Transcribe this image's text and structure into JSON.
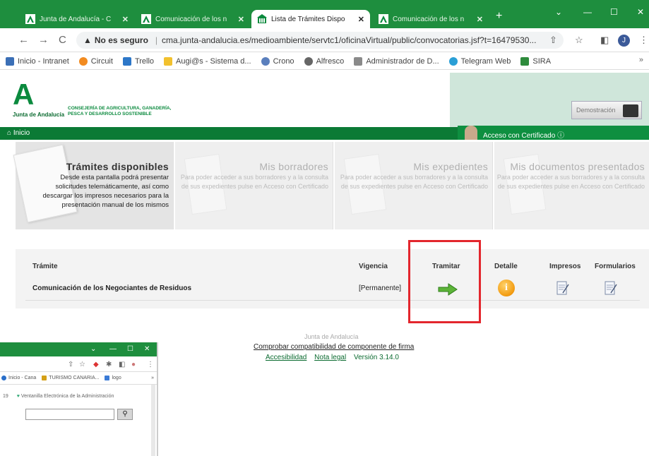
{
  "browser": {
    "tabs": [
      {
        "title": "Junta de Andalucía - C",
        "active": false
      },
      {
        "title": "Comunicación de los n",
        "active": false
      },
      {
        "title": "Lista de Trámites Dispo",
        "active": true
      },
      {
        "title": "Comunicación de los n",
        "active": false
      }
    ],
    "new_tab": "+",
    "window_controls": {
      "minimize": "—",
      "maximize": "☐",
      "close": "✕",
      "chevron": "⌄"
    },
    "nav": {
      "back": "←",
      "forward": "→",
      "reload": "C"
    },
    "address": {
      "security_label": "No es seguro",
      "url": "cma.junta-andalucia.es/medioambiente/servtc1/oficinaVirtual/public/convocatorias.jsf?t=16479530..."
    },
    "profile_initial": "J",
    "bookmarks": [
      {
        "label": "Inicio - Intranet",
        "color": "#3b6fb6"
      },
      {
        "label": "Circuit",
        "color": "#f28b20"
      },
      {
        "label": "Trello",
        "color": "#2d77c8"
      },
      {
        "label": "Augi@s - Sistema d...",
        "color": "#f2c12e"
      },
      {
        "label": "Crono",
        "color": "#5a7fbd"
      },
      {
        "label": "Alfresco",
        "color": "#666666"
      },
      {
        "label": "Administrador de D...",
        "color": "#8a8a8a"
      },
      {
        "label": "Telegram Web",
        "color": "#2a9fd6"
      },
      {
        "label": "SIRA",
        "color": "#2e8b3c"
      }
    ],
    "bookmarks_more": "»"
  },
  "header": {
    "logo_letter": "A",
    "logo_org": "Junta de Andalucía",
    "logo_consejeria_line1": "CONSEJERÍA DE AGRICULTURA, GANADERÍA,",
    "logo_consejeria_line2": "PESCA Y DESARROLLO SOSTENIBLE",
    "demo_button": "Demostración"
  },
  "navbar": {
    "home": "Inicio",
    "access": "Acceso con Certificado"
  },
  "panels": [
    {
      "title": "Trámites disponibles",
      "desc": "Desde esta pantalla podrá presentar solicitudes telemáticamente, así como descargar los impresos necesarios para la presentación manual de los mismos"
    },
    {
      "title": "Mis borradores",
      "desc": "Para poder acceder a sus borradores y a la consulta de sus expedientes pulse en Acceso con Certificado"
    },
    {
      "title": "Mis expedientes",
      "desc": "Para poder acceder a sus borradores y a la consulta de sus expedientes pulse en Acceso con Certificado"
    },
    {
      "title": "Mis documentos presentados",
      "desc": "Para poder acceder a sus borradores y a la consulta de sus expedientes pulse en Acceso con Certificado"
    }
  ],
  "table": {
    "headers": {
      "tramite": "Trámite",
      "vigencia": "Vigencia",
      "tramitar": "Tramitar",
      "detalle": "Detalle",
      "impresos": "Impresos",
      "formularios": "Formularios"
    },
    "rows": [
      {
        "tramite": "Comunicación de los Negociantes de Residuos",
        "vigencia": "[Permanente]"
      }
    ]
  },
  "footer": {
    "org": "Junta de Andalucía",
    "check": "Comprobar compatibilidad de componente de firma",
    "accesibilidad": "Accesibilidad",
    "nota_legal": "Nota legal",
    "version": "Versión 3.14.0"
  },
  "second_window": {
    "bookmarks": [
      {
        "label": "Inicio - Cana",
        "color": "#2a6fc9"
      },
      {
        "label": "TURISMO CANARIA...",
        "color": "#d4a017"
      },
      {
        "label": "logo",
        "color": "#3b7bd6"
      }
    ],
    "row_prefix": "19",
    "row_text": "Ventanilla Electrónica de la Administración",
    "search_icon": "🔍"
  },
  "colors": {
    "brand_green": "#0b7a35",
    "chrome_green": "#1e8e3e",
    "highlight_red": "#e3262d"
  }
}
